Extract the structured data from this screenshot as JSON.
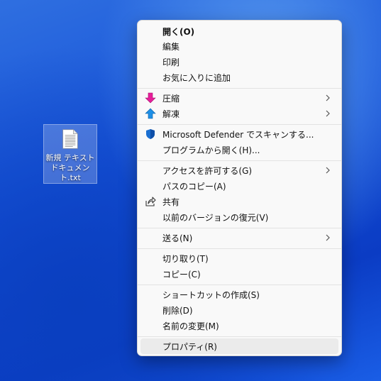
{
  "desktop": {
    "file_icon": {
      "name_line1": "新規 テキスト",
      "name_line2": "ドキュメント.txt",
      "icon": "text-file-icon"
    }
  },
  "context_menu": {
    "items": [
      {
        "label": "開く(O)",
        "bold": true
      },
      {
        "label": "編集"
      },
      {
        "label": "印刷"
      },
      {
        "label": "お気に入りに追加"
      },
      {
        "label": "圧縮",
        "icon": "compress-arrow-icon",
        "submenu": true
      },
      {
        "label": "解凍",
        "icon": "extract-arrow-icon",
        "submenu": true
      },
      {
        "label": "Microsoft Defender でスキャンする...",
        "icon": "defender-shield-icon"
      },
      {
        "label": "プログラムから開く(H)..."
      },
      {
        "label": "アクセスを許可する(G)",
        "submenu": true
      },
      {
        "label": "パスのコピー(A)"
      },
      {
        "label": "共有",
        "icon": "share-icon"
      },
      {
        "label": "以前のバージョンの復元(V)"
      },
      {
        "label": "送る(N)",
        "submenu": true
      },
      {
        "label": "切り取り(T)"
      },
      {
        "label": "コピー(C)"
      },
      {
        "label": "ショートカットの作成(S)"
      },
      {
        "label": "削除(D)"
      },
      {
        "label": "名前の変更(M)"
      },
      {
        "label": "プロパティ(R)",
        "highlighted": true
      }
    ]
  },
  "colors": {
    "compress_arrow": "#e61e9a",
    "extract_arrow": "#1e8fe6",
    "defender_shield": "#1a6fd1"
  }
}
